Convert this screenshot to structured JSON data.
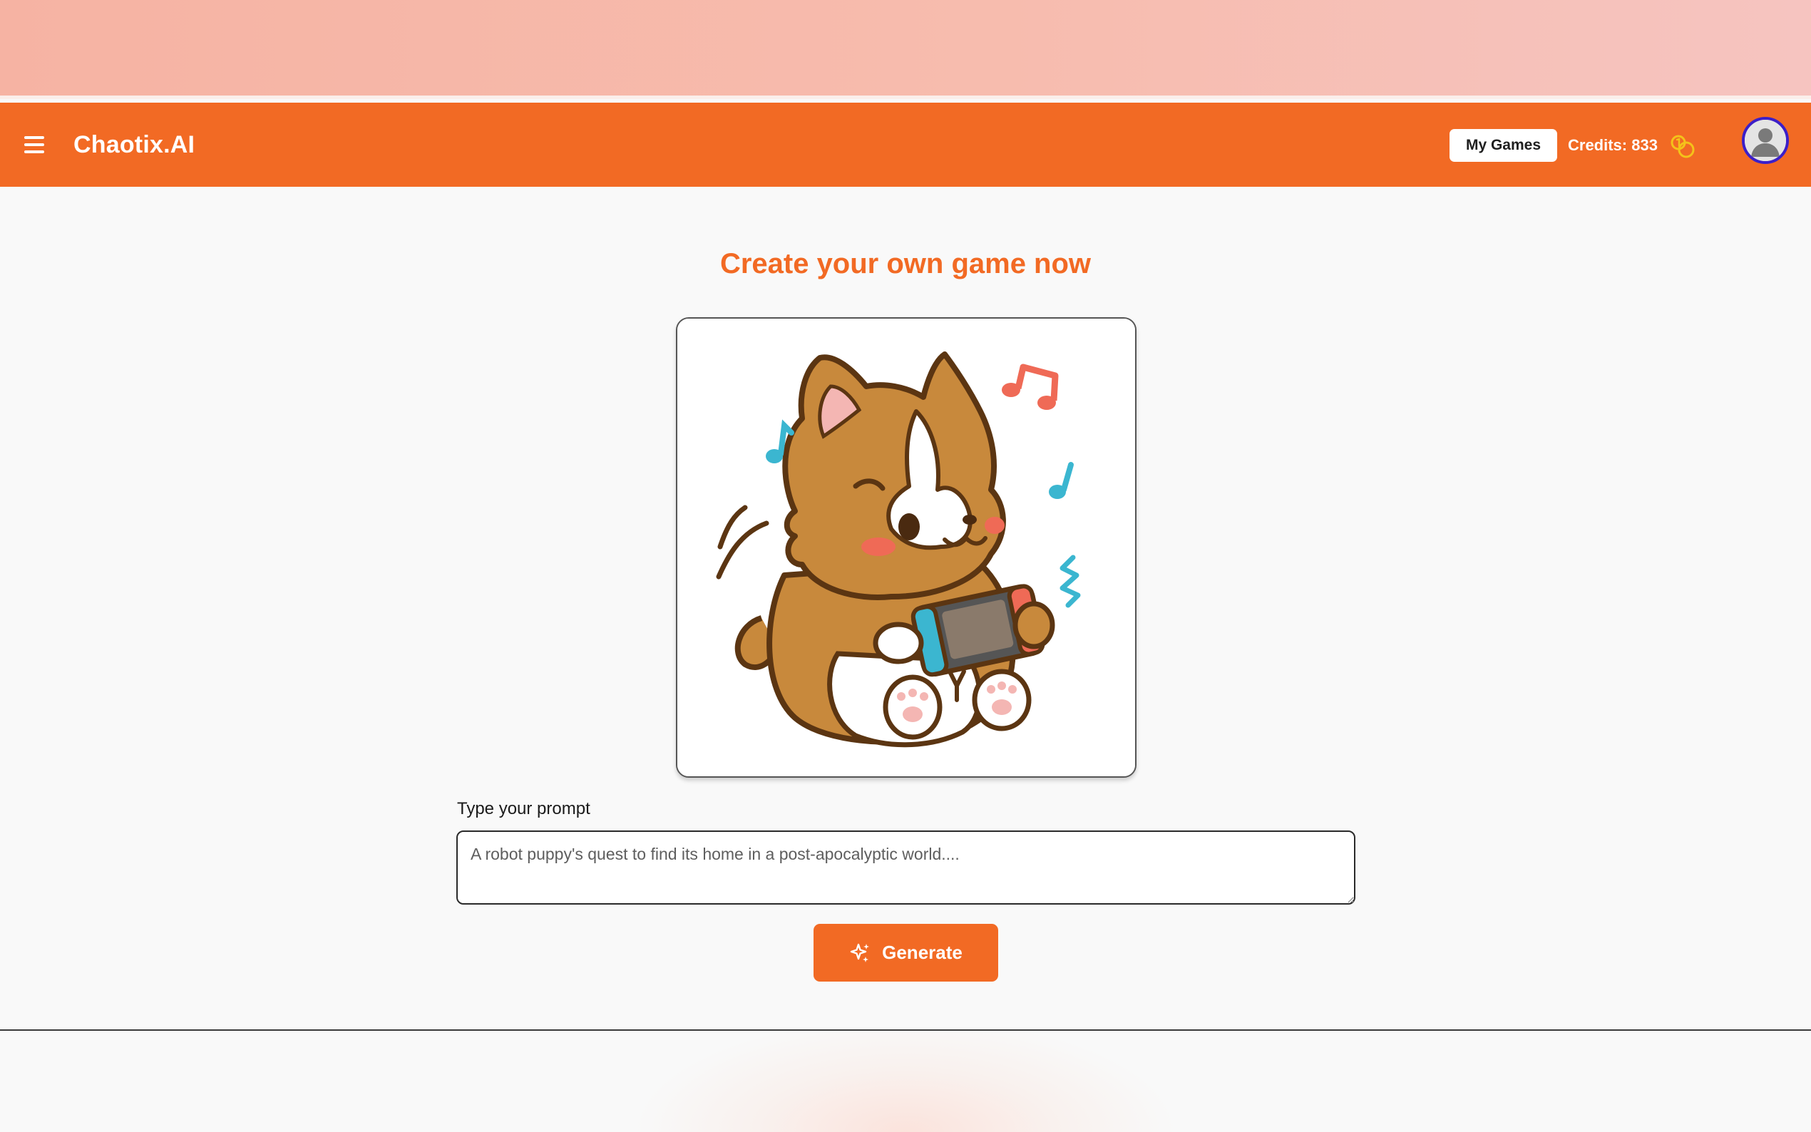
{
  "header": {
    "brand": "Chaotix.AI",
    "my_games_label": "My Games",
    "credits_label": "Credits: 833",
    "menu_icon": "hamburger-menu-icon",
    "credits_icon": "coins-icon",
    "avatar_icon": "user-avatar-icon"
  },
  "main": {
    "title": "Create your own game now",
    "hero_image": "corgi-playing-handheld-console-illustration",
    "prompt": {
      "label": "Type your prompt",
      "placeholder": "A robot puppy's quest to find its home in a post-apocalyptic world....",
      "value": ""
    },
    "generate_label": "Generate",
    "generate_icon": "sparkles-icon"
  },
  "colors": {
    "accent": "#f26a24",
    "background": "#f9f9f9",
    "banner": "#f6b3a3",
    "avatar_ring": "#3c1fc8",
    "coin": "#f4c21a"
  }
}
